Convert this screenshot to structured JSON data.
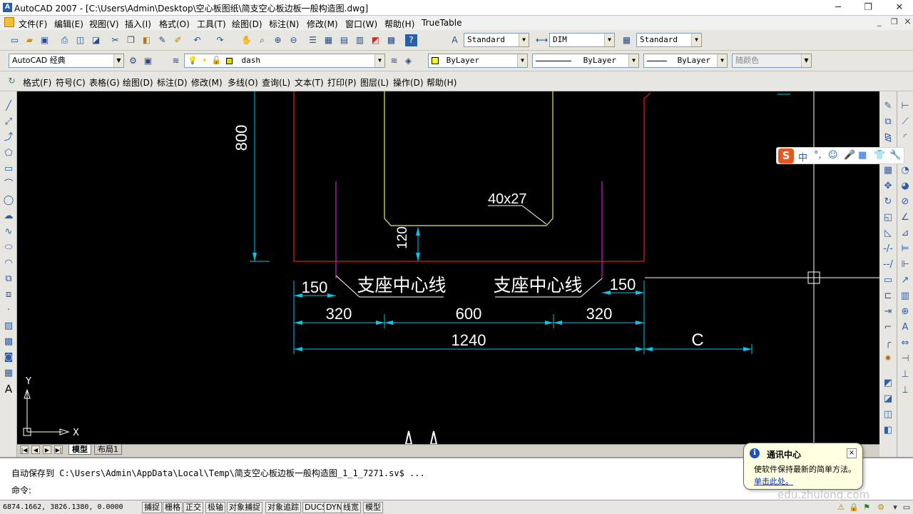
{
  "window": {
    "title": "AutoCAD 2007 - [C:\\Users\\Admin\\Desktop\\空心板图纸\\简支空心板边板一般构造图.dwg]",
    "minimize": "─",
    "restore": "❐",
    "close": "✕",
    "doc_minimize": "_",
    "doc_restore": "❐",
    "doc_close": "×"
  },
  "menubar": {
    "items": [
      "文件(F)",
      "编辑(E)",
      "视图(V)",
      "插入(I)",
      "格式(O)",
      "工具(T)",
      "绘图(D)",
      "标注(N)",
      "修改(M)",
      "窗口(W)",
      "帮助(H)",
      "TrueTable"
    ]
  },
  "styles_toolbar": {
    "text_style": "Standard",
    "dim_style": "DIM",
    "table_style": "Standard"
  },
  "workspace_toolbar": {
    "workspace": "AutoCAD 经典",
    "layer": "dash",
    "color": "ByLayer",
    "linetype": "ByLayer",
    "lineweight": "ByLayer",
    "plotstyle": "随颜色"
  },
  "menu2": {
    "items": [
      "格式(F)",
      "符号(C)",
      "表格(G)",
      "绘图(D)",
      "标注(D)",
      "修改(M)",
      "多线(O)",
      "查询(L)",
      "文本(T)",
      "打印(P)",
      "图层(L)",
      "操作(D)",
      "帮助(H)"
    ]
  },
  "drawing": {
    "dim_800": "800",
    "label_40x27": "40x27",
    "dim_120": "120",
    "dim_150_left": "150",
    "label_support_left": "支座中心线",
    "label_support_right": "支座中心线",
    "dim_150_right": "150",
    "dim_320_left": "320",
    "dim_600": "600",
    "dim_320_right": "320",
    "dim_1240": "1240",
    "dim_C": "C",
    "ucs_x": "X",
    "ucs_y": "Y",
    "colors": {
      "background": "#000000",
      "red": "#e01818",
      "yellow": "#e8e870",
      "magenta": "#d020d0",
      "cyan": "#00c8e8",
      "white": "#ffffff"
    }
  },
  "tabs": {
    "model": "模型",
    "layout1": "布局1"
  },
  "command": {
    "autosave_label": "自动保存到",
    "autosave_path": "C:\\Users\\Admin\\AppData\\Local\\Temp\\简支空心板边板一般构造图_1_1_7271.sv$ ...",
    "prompt": "命令:"
  },
  "status": {
    "coords": "6874.1662, 3826.1380, 0.0000",
    "buttons": [
      "捕捉",
      "栅格",
      "正交",
      "极轴",
      "对象捕捉",
      "对象追踪",
      "DUCS",
      "DYN",
      "线宽",
      "模型"
    ]
  },
  "notification": {
    "title": "通讯中心",
    "body": "使软件保持最新的简单方法。",
    "link": "单击此处。",
    "close": "×"
  },
  "ime": {
    "logo": "S",
    "items": [
      "中",
      "°,",
      "☺",
      "🎤",
      "▦",
      "👕",
      "🔧"
    ]
  },
  "watermark": "edu.zhulong.com"
}
